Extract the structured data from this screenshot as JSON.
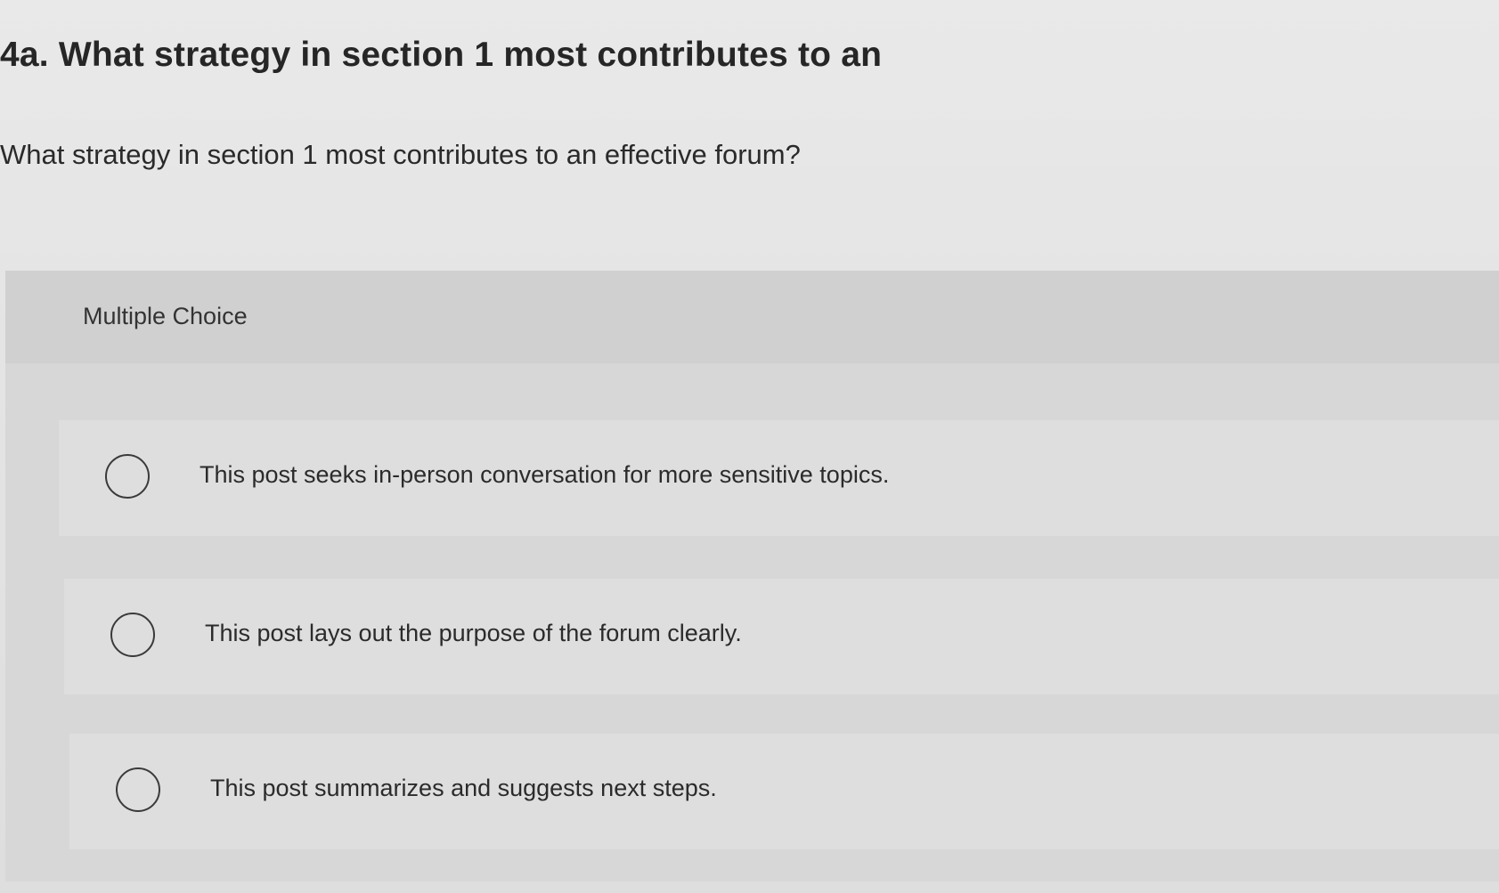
{
  "question_heading": "4a. What strategy in section 1 most contributes to an",
  "question_text": "What strategy in section 1 most contributes to an effective forum?",
  "multiple_choice": {
    "label": "Multiple Choice",
    "options": [
      {
        "label": "This post seeks in-person conversation for more sensitive topics.",
        "selected": false
      },
      {
        "label": "This post lays out the purpose of the forum clearly.",
        "selected": false
      },
      {
        "label": "This post summarizes and suggests next steps.",
        "selected": false
      }
    ]
  }
}
